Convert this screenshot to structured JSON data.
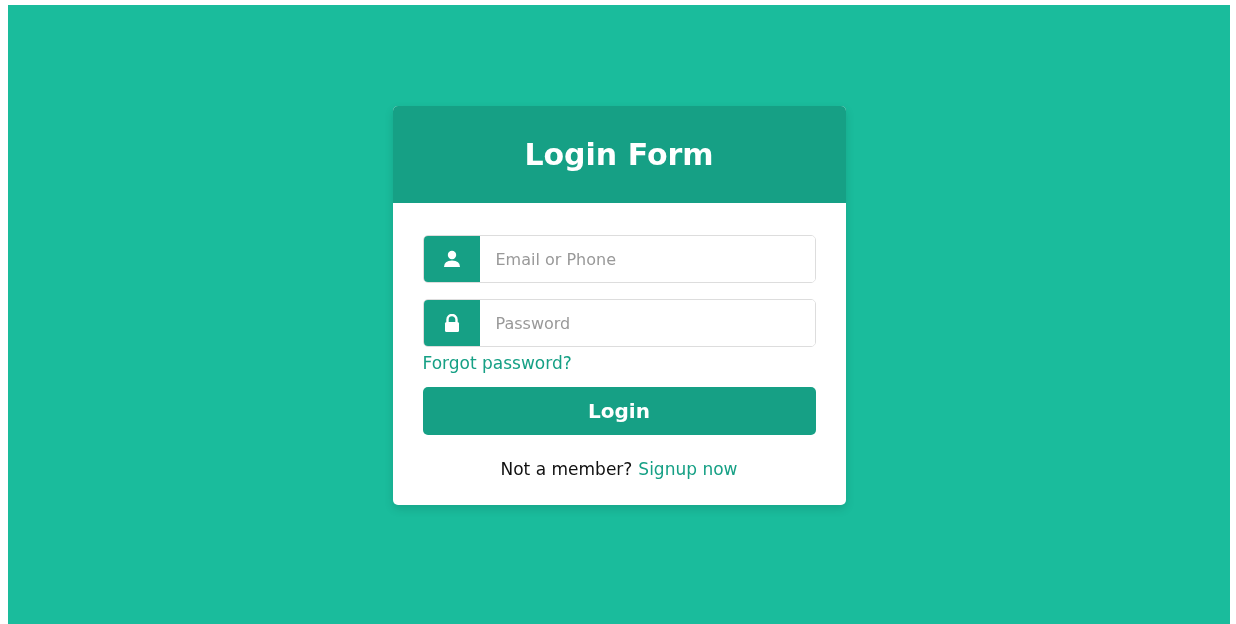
{
  "form": {
    "title": "Login Form",
    "fields": [
      {
        "kind": "user",
        "placeholder": "Email or Phone"
      },
      {
        "kind": "lock",
        "placeholder": "Password"
      }
    ],
    "forgot_link": "Forgot password?",
    "submit": "Login",
    "signup": {
      "prompt": "Not a member?",
      "link": "Signup now"
    }
  }
}
